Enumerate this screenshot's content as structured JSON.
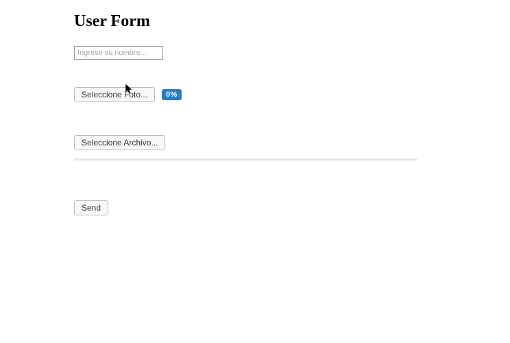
{
  "title": "User Form",
  "name_input": {
    "placeholder": "Ingrese su nombre..."
  },
  "photo_button_label": "Seleccione Foto...",
  "photo_progress_label": "0%",
  "file_button_label": "Seleccione Archivo...",
  "send_button_label": "Send"
}
